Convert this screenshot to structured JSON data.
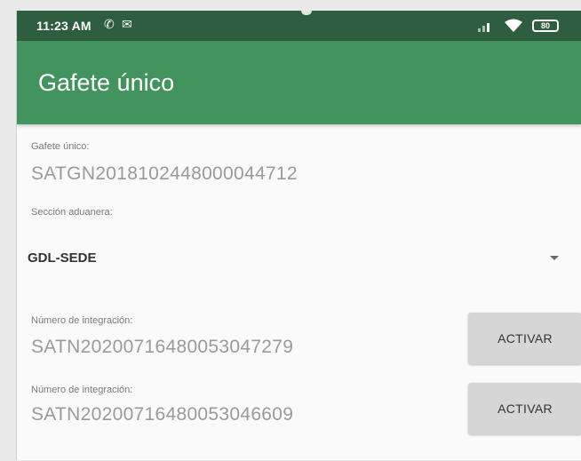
{
  "status_bar": {
    "time": "11:23 AM",
    "icons": [
      "whatsapp-icon",
      "message-icon",
      "signal-icon",
      "wifi-icon",
      "battery-icon"
    ],
    "battery_text": "80"
  },
  "app_bar": {
    "title": "Gafete único"
  },
  "form": {
    "gafete": {
      "label": "Gafete único:",
      "value": "SATGN2018102448000044712"
    },
    "seccion": {
      "label": "Sección aduanera:",
      "selected": "GDL-SEDE"
    },
    "integraciones": [
      {
        "label": "Número de integración:",
        "value": "SATN20200716480053047279",
        "button": "ACTIVAR"
      },
      {
        "label": "Número de integración:",
        "value": "SATN20200716480053046609",
        "button": "ACTIVAR"
      }
    ]
  },
  "colors": {
    "status_bar": "#2f5d40",
    "app_bar": "#43935f",
    "button": "#d6d6d6"
  }
}
